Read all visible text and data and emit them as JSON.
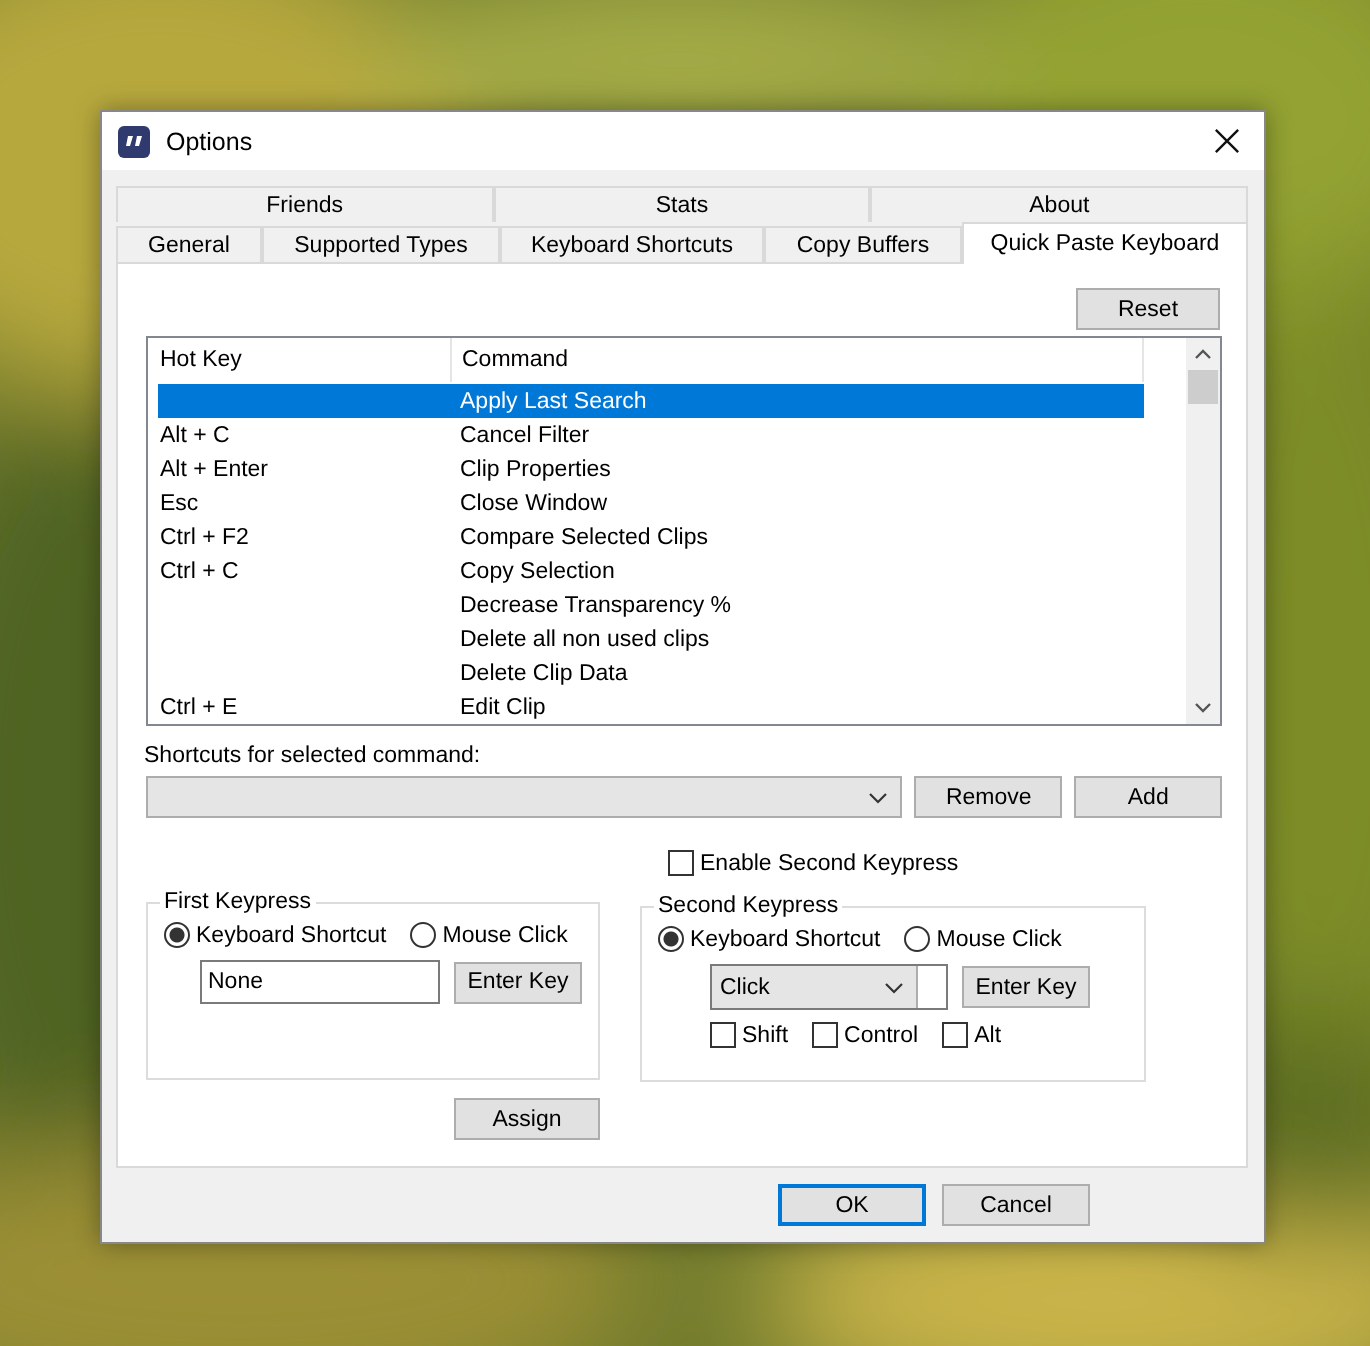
{
  "window": {
    "title": "Options"
  },
  "tab_rows": [
    {
      "tabs": [
        {
          "label": "Friends",
          "selected": false
        },
        {
          "label": "Stats",
          "selected": false
        },
        {
          "label": "About",
          "selected": false
        }
      ]
    },
    {
      "tabs": [
        {
          "label": "General",
          "selected": false
        },
        {
          "label": "Supported Types",
          "selected": false
        },
        {
          "label": "Keyboard Shortcuts",
          "selected": false
        },
        {
          "label": "Copy Buffers",
          "selected": false
        },
        {
          "label": "Quick Paste Keyboard",
          "selected": true
        }
      ]
    }
  ],
  "reset_button": "Reset",
  "list": {
    "columns": [
      "Hot Key",
      "Command"
    ],
    "rows": [
      {
        "hot_key": "",
        "command": "Apply Last Search",
        "selected": true
      },
      {
        "hot_key": "Alt + C",
        "command": "Cancel Filter",
        "selected": false
      },
      {
        "hot_key": "Alt + Enter",
        "command": "Clip Properties",
        "selected": false
      },
      {
        "hot_key": "Esc",
        "command": "Close Window",
        "selected": false
      },
      {
        "hot_key": "Ctrl + F2",
        "command": "Compare Selected Clips",
        "selected": false
      },
      {
        "hot_key": "Ctrl + C",
        "command": "Copy Selection",
        "selected": false
      },
      {
        "hot_key": "",
        "command": "Decrease Transparency %",
        "selected": false
      },
      {
        "hot_key": "",
        "command": "Delete all non used clips",
        "selected": false
      },
      {
        "hot_key": "",
        "command": "Delete Clip Data",
        "selected": false
      },
      {
        "hot_key": "Ctrl + E",
        "command": "Edit Clip",
        "selected": false
      }
    ]
  },
  "shortcuts_label": "Shortcuts for selected command:",
  "shortcut_buttons": [
    "Remove",
    "Add"
  ],
  "enable_second_keypress": {
    "label": "Enable Second Keypress",
    "checked": false
  },
  "first_keypress": {
    "title": "First Keypress",
    "options": [
      {
        "label": "Keyboard Shortcut",
        "selected": true
      },
      {
        "label": "Mouse Click",
        "selected": false
      }
    ],
    "key_value": "None",
    "button": "Enter Key"
  },
  "second_keypress": {
    "title": "Second Keypress",
    "options": [
      {
        "label": "Keyboard Shortcut",
        "selected": true
      },
      {
        "label": "Mouse Click",
        "selected": false
      }
    ],
    "key_value": "Click",
    "button": "Enter Key",
    "modifiers": [
      {
        "label": "Shift",
        "checked": false
      },
      {
        "label": "Control",
        "checked": false
      },
      {
        "label": "Alt",
        "checked": false
      }
    ]
  },
  "assign_button": "Assign",
  "footer_buttons": [
    {
      "label": "OK",
      "default": true
    },
    {
      "label": "Cancel",
      "default": false
    }
  ]
}
